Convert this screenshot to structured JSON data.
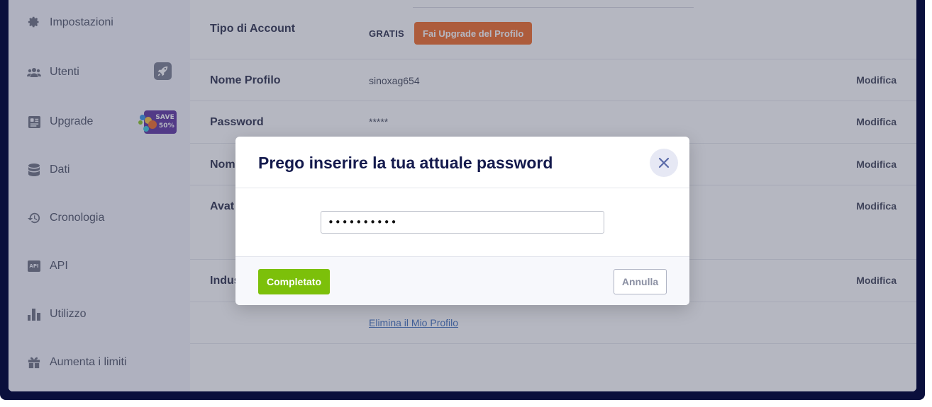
{
  "sidebar": {
    "items": [
      {
        "label": "Impostazioni",
        "icon": "gear-icon"
      },
      {
        "label": "Utenti",
        "icon": "users-icon"
      },
      {
        "label": "Upgrade",
        "icon": "id-card-icon"
      },
      {
        "label": "Dati",
        "icon": "database-icon"
      },
      {
        "label": "Cronologia",
        "icon": "history-icon"
      },
      {
        "label": "API",
        "icon": "api-icon"
      },
      {
        "label": "Utilizzo",
        "icon": "bar-chart-icon"
      },
      {
        "label": "Aumenta i limiti",
        "icon": "gift-icon"
      }
    ],
    "api_icon_text": "API",
    "save_badge": {
      "line1": "SAVE",
      "line2": "50%"
    }
  },
  "account": {
    "type_label": "Tipo di Account",
    "type_value": "GRATIS",
    "upgrade_button": "Fai Upgrade del Profilo",
    "rows": [
      {
        "label": "Nome Profilo",
        "value": "sinoxag654",
        "action": "Modifica"
      },
      {
        "label": "Password",
        "value": "*****",
        "action": "Modifica"
      },
      {
        "label": "Nom",
        "value": "",
        "action": "Modifica"
      },
      {
        "label": "Avat",
        "value": "",
        "action": "Modifica"
      },
      {
        "label": "Indus",
        "value": "",
        "action": "Modifica"
      }
    ],
    "delete_link": "Elimina il Mio Profilo"
  },
  "modal": {
    "title": "Prego inserire la tua attuale password",
    "password_value": "••••••••••",
    "confirm_button": "Completato",
    "cancel_button": "Annulla"
  },
  "colors": {
    "accent_orange": "#f15a0e",
    "confirm_green": "#7cc00a",
    "title_navy": "#141a4d",
    "frame": "#0a0f3c"
  }
}
